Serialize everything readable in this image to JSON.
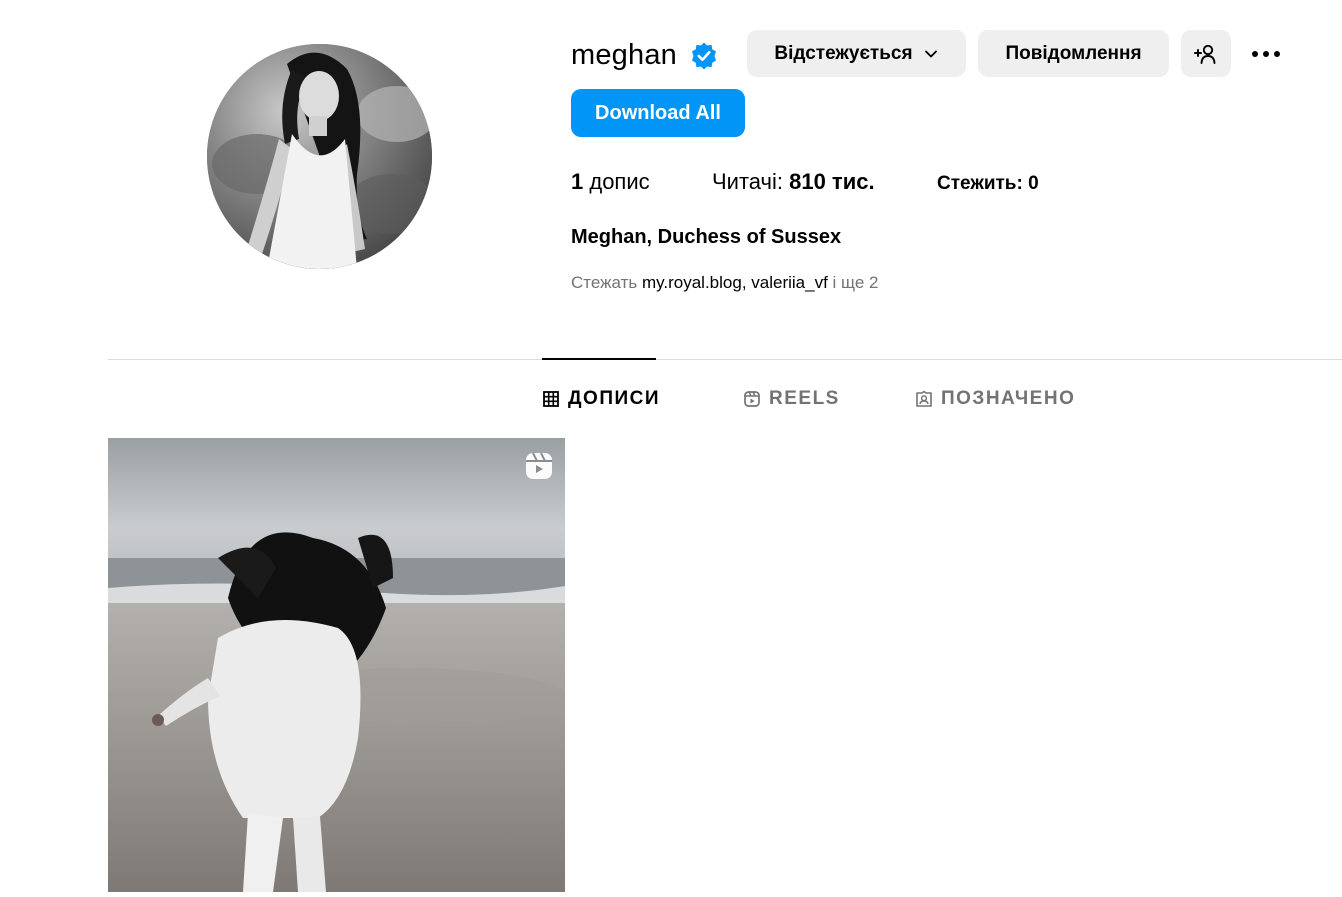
{
  "profile": {
    "username": "meghan",
    "verified": true,
    "follow_button_label": "Відстежується",
    "message_button_label": "Повідомлення",
    "download_button_label": "Download All",
    "full_name": "Meghan, Duchess of Sussex"
  },
  "stats": {
    "posts_count": "1",
    "posts_label": " допис",
    "followers_label": "Читачі: ",
    "followers_count": "810 тис.",
    "following_label": "Стежить: 0"
  },
  "followed_by": {
    "prefix": "Стежать ",
    "accounts": [
      "my.royal.blog",
      "valeriia_vf"
    ],
    "separator": ", ",
    "suffix": " і ще 2"
  },
  "tabs": [
    {
      "label": "ДОПИСИ",
      "icon": "grid-icon",
      "active": true
    },
    {
      "label": "REELS",
      "icon": "reels-icon",
      "active": false
    },
    {
      "label": "ПОЗНАЧЕНО",
      "icon": "tagged-icon",
      "active": false
    }
  ],
  "colors": {
    "primary_button": "#0095f6",
    "secondary_button": "#efefef",
    "verified_badge": "#0095f6",
    "muted_text": "#737373",
    "divider": "#dbdbdb"
  },
  "posts": [
    {
      "type": "reel",
      "icon": "reel-badge-icon"
    }
  ]
}
